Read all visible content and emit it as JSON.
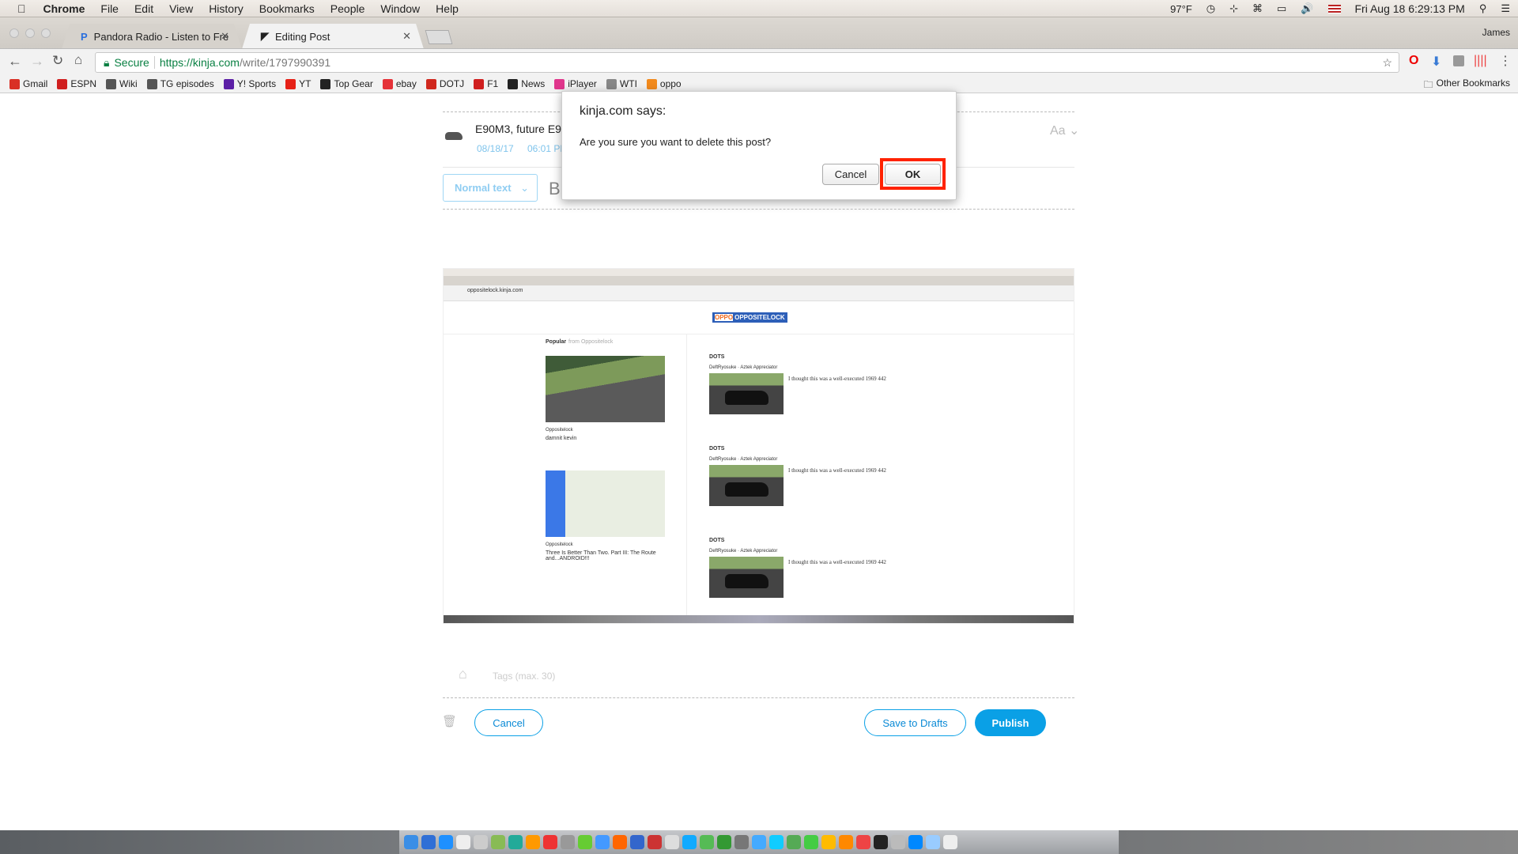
{
  "menubar": {
    "app": "Chrome",
    "items": [
      "File",
      "Edit",
      "View",
      "History",
      "Bookmarks",
      "People",
      "Window",
      "Help"
    ],
    "status": {
      "temperature": "97°F",
      "datetime": "Fri Aug 18  6:29:13 PM"
    }
  },
  "tabs": [
    {
      "title": "Pandora Radio - Listen to Free",
      "active": false
    },
    {
      "title": "Editing Post",
      "active": true
    }
  ],
  "profile": "James",
  "address": {
    "secure_label": "Secure",
    "url_host": "https://kinja.com",
    "url_path": "/write/1797990391"
  },
  "bookmarks": [
    {
      "label": "Gmail",
      "color": "#d93025"
    },
    {
      "label": "ESPN",
      "color": "#d01f1f"
    },
    {
      "label": "Wiki",
      "color": "#555"
    },
    {
      "label": "TG episodes",
      "color": "#555"
    },
    {
      "label": "Y! Sports",
      "color": "#5c1fa6"
    },
    {
      "label": "YT",
      "color": "#e62117"
    },
    {
      "label": "Top Gear",
      "color": "#222"
    },
    {
      "label": "ebay",
      "color": "#e53238"
    },
    {
      "label": "DOTJ",
      "color": "#d0281e"
    },
    {
      "label": "F1",
      "color": "#d01f1f"
    },
    {
      "label": "News",
      "color": "#222"
    },
    {
      "label": "iPlayer",
      "color": "#e0368c"
    },
    {
      "label": "WTI",
      "color": "#888"
    },
    {
      "label": "oppo",
      "color": "#f28a1d"
    }
  ],
  "other_bookmarks": "Other Bookmarks",
  "editor": {
    "post_title": "E90M3, future E9X",
    "date": "08/18/17",
    "time": "06:01 PM",
    "font_toggle": "Aa",
    "format_select": "Normal text",
    "bold": "B",
    "tags_placeholder": "Tags (max. 30)",
    "cancel": "Cancel",
    "save_drafts": "Save to Drafts",
    "publish": "Publish",
    "accent": "#0aa0e6"
  },
  "embedded": {
    "url": "oppositelock.kinja.com",
    "logo": "OPPOSITELOCK",
    "popular": "Popular",
    "popular_from": "from Oppositelock",
    "side": [
      {
        "site": "Oppositelock",
        "title": "damnit kevin"
      },
      {
        "site": "Oppositelock",
        "title": "Three Is Better Than Two. Part III: The Route and...ANDROID!!!"
      }
    ],
    "posts": [
      {
        "title": "DOTS",
        "byline": "DeftRyosuke · Aztek Appreciator",
        "excerpt": "I thought this was a well-executed 1969 442"
      },
      {
        "title": "DOTS",
        "byline": "DeftRyosuke · Aztek Appreciator",
        "excerpt": "I thought this was a well-executed 1969 442"
      },
      {
        "title": "DOTS",
        "byline": "DeftRyosuke · Aztek Appreciator",
        "excerpt": "I thought this was a well-executed 1969 442"
      }
    ]
  },
  "dialog": {
    "title": "kinja.com says:",
    "message": "Are you sure you want to delete this post?",
    "cancel": "Cancel",
    "ok": "OK",
    "highlight": "#ff2200"
  }
}
